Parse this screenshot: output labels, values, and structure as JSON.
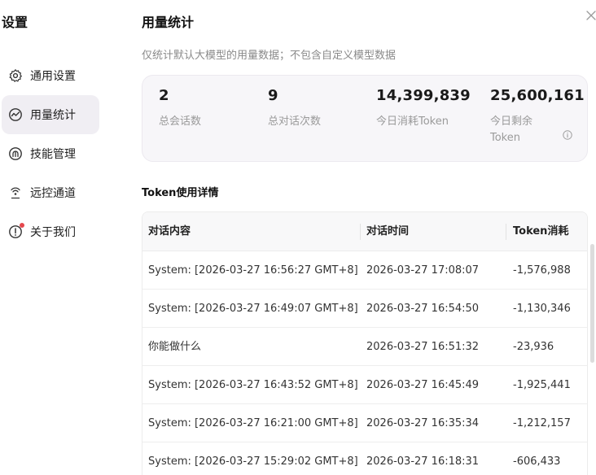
{
  "sidebar": {
    "title": "设置",
    "items": [
      {
        "label": "通用设置",
        "icon": "gear-icon",
        "active": false
      },
      {
        "label": "用量统计",
        "icon": "chart-icon",
        "active": true
      },
      {
        "label": "技能管理",
        "icon": "brain-icon",
        "active": false
      },
      {
        "label": "远控通道",
        "icon": "signal-icon",
        "active": false
      },
      {
        "label": "关于我们",
        "icon": "info-icon",
        "active": false,
        "badge": true
      }
    ]
  },
  "main": {
    "title": "用量统计",
    "subtitle": "仅统计默认大模型的用量数据；不包含自定义模型数据",
    "stats": [
      {
        "value": "2",
        "label": "总会话数"
      },
      {
        "value": "9",
        "label": "总对话次数"
      },
      {
        "value": "14,399,839",
        "label": "今日消耗Token"
      },
      {
        "value": "25,600,161",
        "label": "今日剩余Token"
      }
    ],
    "section_title": "Token使用详情",
    "table": {
      "headers": [
        "对话内容",
        "对话时间",
        "Token消耗"
      ],
      "rows": [
        {
          "content": "System: [2026-03-27 16:56:27 GMT+8] ...",
          "time": "2026-03-27 17:08:07",
          "tokens": "-1,576,988"
        },
        {
          "content": "System: [2026-03-27 16:49:07 GMT+8] ...",
          "time": "2026-03-27 16:54:50",
          "tokens": "-1,130,346"
        },
        {
          "content": "你能做什么",
          "time": "2026-03-27 16:51:32",
          "tokens": "-23,936"
        },
        {
          "content": "System: [2026-03-27 16:43:52 GMT+8] ...",
          "time": "2026-03-27 16:45:49",
          "tokens": "-1,925,441"
        },
        {
          "content": "System: [2026-03-27 16:21:00 GMT+8] ...",
          "time": "2026-03-27 16:35:34",
          "tokens": "-1,212,157"
        },
        {
          "content": "System: [2026-03-27 15:29:02 GMT+8] ...",
          "time": "2026-03-27 16:18:31",
          "tokens": "-606,433"
        }
      ]
    }
  },
  "colors": {
    "active_bg": "#f0eef3",
    "card_bg": "#f7f6f9",
    "badge": "#e5484d"
  }
}
